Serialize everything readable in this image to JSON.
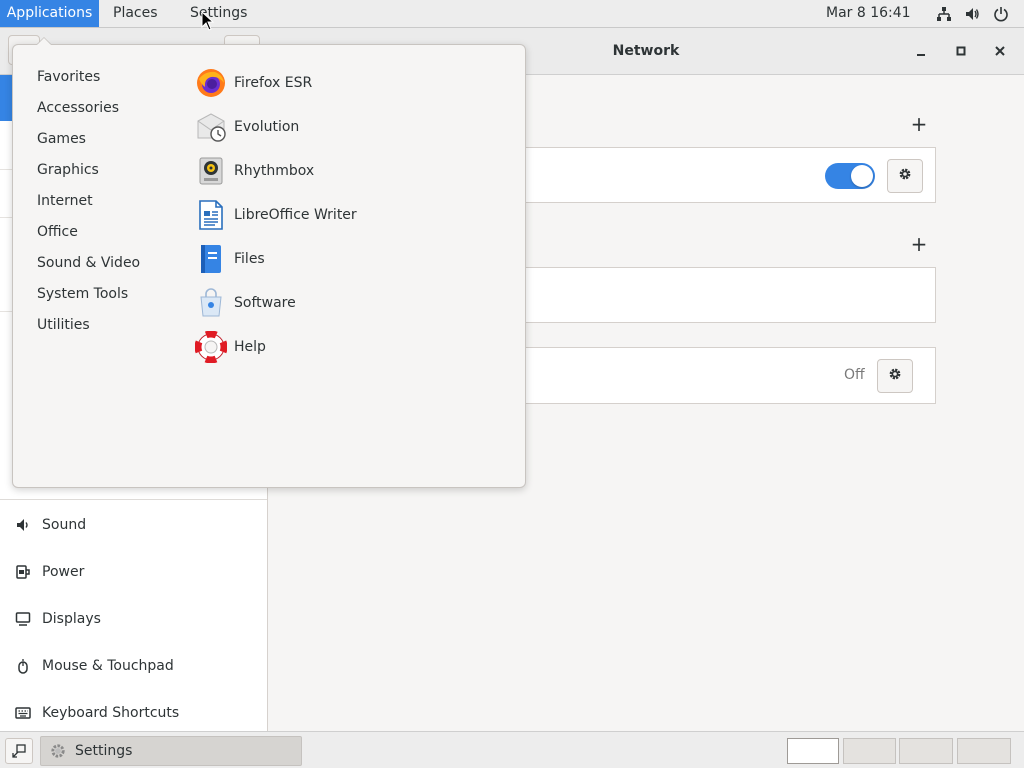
{
  "topbar": {
    "applications": "Applications",
    "places": "Places",
    "settings": "Settings",
    "clock": "Mar 8  16:41",
    "tray_icons": [
      "network-wired-icon",
      "volume-icon",
      "power-icon"
    ]
  },
  "window": {
    "title": "Network",
    "controls": [
      "minimize-icon",
      "maximize-icon",
      "close-icon"
    ]
  },
  "sidebar": {
    "items": [
      {
        "label": "Sound",
        "icon": "speaker-icon"
      },
      {
        "label": "Power",
        "icon": "power-plug-icon"
      },
      {
        "label": "Displays",
        "icon": "monitor-icon"
      },
      {
        "label": "Mouse & Touchpad",
        "icon": "mouse-icon"
      },
      {
        "label": "Keyboard Shortcuts",
        "icon": "keyboard-icon"
      }
    ]
  },
  "network": {
    "toggle_on": true,
    "proxy_status": "Off"
  },
  "menu": {
    "categories": [
      "Favorites",
      "Accessories",
      "Games",
      "Graphics",
      "Internet",
      "Office",
      "Sound & Video",
      "System Tools",
      "Utilities"
    ],
    "apps": [
      {
        "label": "Firefox ESR",
        "icon": "firefox-icon"
      },
      {
        "label": "Evolution",
        "icon": "evolution-icon"
      },
      {
        "label": "Rhythmbox",
        "icon": "rhythmbox-icon"
      },
      {
        "label": "LibreOffice Writer",
        "icon": "libreoffice-writer-icon"
      },
      {
        "label": "Files",
        "icon": "files-icon"
      },
      {
        "label": "Software",
        "icon": "software-icon"
      },
      {
        "label": "Help",
        "icon": "help-lifebuoy-icon"
      }
    ]
  },
  "taskbar": {
    "window_label": "Settings",
    "workspaces": 4,
    "active_workspace": 1
  },
  "colors": {
    "accent": "#3584e4",
    "panel": "#ededed",
    "window_bg": "#f6f5f4"
  }
}
